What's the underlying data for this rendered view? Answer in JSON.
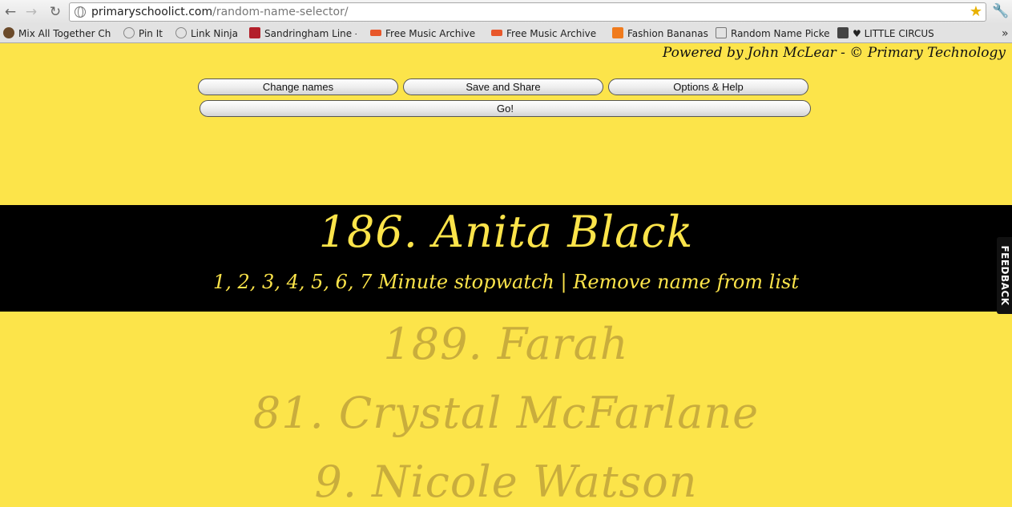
{
  "browser": {
    "url_domain": "primaryschoolict.com",
    "url_path": "/random-name-selector/",
    "bookmarks": [
      {
        "label": "Mix All Together Ch",
        "color": "#6b4a2a"
      },
      {
        "label": "Pin It",
        "color": "#888888"
      },
      {
        "label": "Link Ninja",
        "color": "#888888"
      },
      {
        "label": "Sandringham Line -",
        "color": "#b3202a"
      },
      {
        "label": "Free Music Archive",
        "color": "#e8572a"
      },
      {
        "label": "Free Music Archive",
        "color": "#e8572a"
      },
      {
        "label": "Fashion Bananas",
        "color": "#f07b1d"
      },
      {
        "label": "Random Name Picker",
        "color": "#777777"
      },
      {
        "label": "♥ LITTLE CIRCUS DE",
        "color": "#444444"
      }
    ]
  },
  "page": {
    "powered_by": "Powered by John McLear - © Primary Technology",
    "buttons": {
      "change_names": "Change names",
      "save_share": "Save and Share",
      "options_help": "Options & Help",
      "go": "Go!"
    },
    "selected_name": "186. Anita Black",
    "links": {
      "stopwatch": "1, 2, 3, 4, 5, 6, 7 Minute stopwatch",
      "separator": "|",
      "remove": "Remove name from list"
    },
    "previous_names": [
      "189. Farah",
      "81. Crystal McFarlane",
      "9. Nicole Watson"
    ],
    "feedback": "FEEDBACK"
  },
  "colors": {
    "background": "#fce44a",
    "band": "#000000",
    "faded_text": "#c9ad3c"
  }
}
